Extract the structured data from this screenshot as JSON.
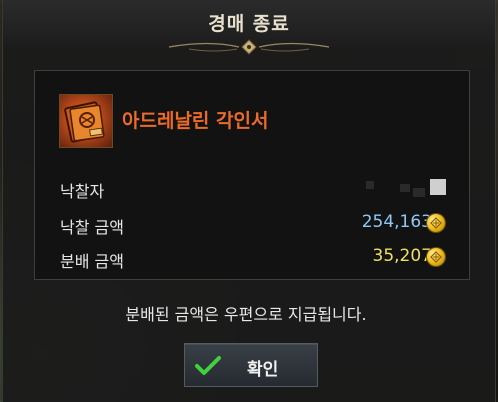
{
  "dialog": {
    "title": "경매 종료",
    "item_name": "아드레날린 각인서",
    "rows": [
      {
        "label": "낙찰자",
        "value": ""
      },
      {
        "label": "낙찰 금액",
        "value": "254,163"
      },
      {
        "label": "분배 금액",
        "value": "35,207"
      }
    ],
    "notice": "분배된 금액은 우편으로 지급됩니다.",
    "confirm_label": "확인"
  },
  "colors": {
    "item_name": "#ec6a2a",
    "winning_bid": "#8ec8f4",
    "distribution": "#f0e060",
    "gold_coin": "#f0c020",
    "checkmark": "#3fd23f"
  },
  "icons": [
    "scroll-book-icon",
    "gold-coin-icon",
    "checkmark-icon",
    "title-ornament-icon"
  ]
}
